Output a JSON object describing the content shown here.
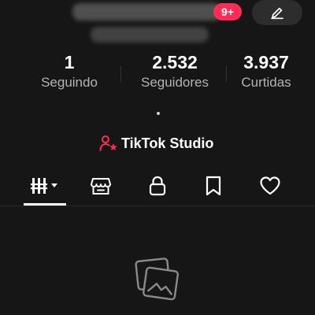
{
  "header": {
    "notification_badge": "9+",
    "edit_icon": "pencil-icon"
  },
  "stats": [
    {
      "value": "1",
      "label": "Seguindo"
    },
    {
      "value": "2.532",
      "label": "Seguidores"
    },
    {
      "value": "3.937",
      "label": "Curtidas"
    }
  ],
  "studio": {
    "icon": "person-star-icon",
    "label": "TikTok Studio"
  },
  "tabs": [
    {
      "icon": "videos-grid-icon",
      "selected": true
    },
    {
      "icon": "shop-icon",
      "selected": false
    },
    {
      "icon": "lock-icon",
      "selected": false
    },
    {
      "icon": "bookmark-icon",
      "selected": false
    },
    {
      "icon": "heart-icon",
      "selected": false
    }
  ],
  "empty_state": {
    "icon": "photos-icon"
  },
  "colors": {
    "background": "#161616",
    "accent": "#fe2c55",
    "text_secondary": "#b3b3b3"
  }
}
